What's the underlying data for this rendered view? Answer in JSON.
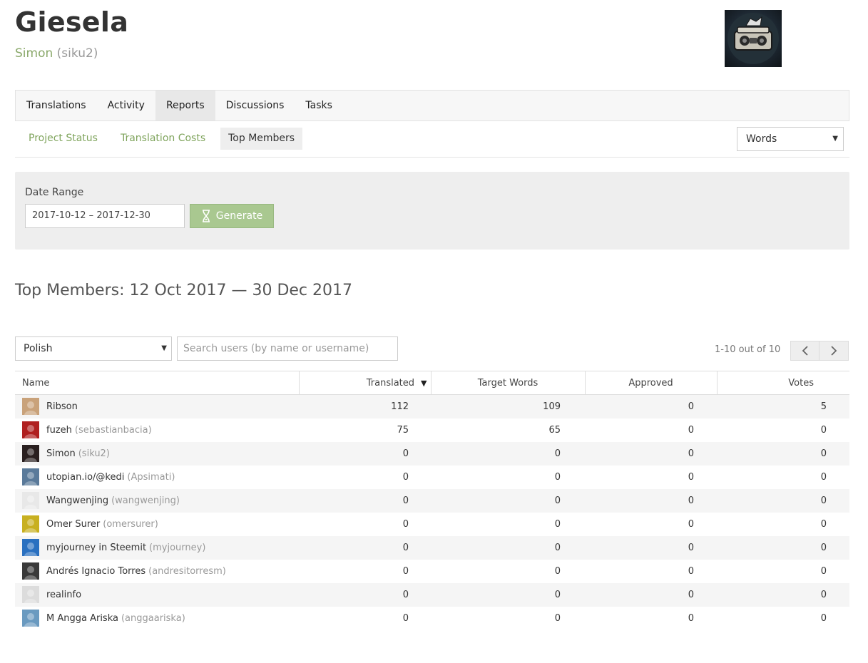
{
  "project": {
    "title": "Giesela",
    "owner_name": "Simon",
    "owner_username": "(siku2)"
  },
  "main_tabs": [
    {
      "label": "Translations"
    },
    {
      "label": "Activity"
    },
    {
      "label": "Reports",
      "active": true
    },
    {
      "label": "Discussions"
    },
    {
      "label": "Tasks"
    }
  ],
  "report_tabs": [
    {
      "label": "Project Status"
    },
    {
      "label": "Translation Costs"
    },
    {
      "label": "Top Members",
      "active": true
    }
  ],
  "units_select": {
    "value": "Words"
  },
  "filters": {
    "date_label": "Date Range",
    "date_value": "2017-10-12 – 2017-12-30",
    "generate_label": "Generate"
  },
  "report_title": "Top Members: 12 Oct 2017 — 30 Dec 2017",
  "language_select": {
    "value": "Polish"
  },
  "search": {
    "placeholder": "Search users (by name or username)"
  },
  "pagination": {
    "info": "1-10 out of 10"
  },
  "table": {
    "columns": [
      "Name",
      "Translated",
      "Target Words",
      "Approved",
      "Votes"
    ],
    "sorted_column": "Translated",
    "rows": [
      {
        "name": "Ribson",
        "username": "",
        "translated": "112",
        "target_words": "109",
        "approved": "0",
        "votes": "5",
        "avatar_color": "#c9a27a"
      },
      {
        "name": "fuzeh",
        "username": "(sebastianbacia)",
        "translated": "75",
        "target_words": "65",
        "approved": "0",
        "votes": "0",
        "avatar_color": "#b02020"
      },
      {
        "name": "Simon",
        "username": "(siku2)",
        "translated": "0",
        "target_words": "0",
        "approved": "0",
        "votes": "0",
        "avatar_color": "#2a2020"
      },
      {
        "name": "utopian.io/@kedi",
        "username": "(Apsimati)",
        "translated": "0",
        "target_words": "0",
        "approved": "0",
        "votes": "0",
        "avatar_color": "#5a7a9a"
      },
      {
        "name": "Wangwenjing",
        "username": "(wangwenjing)",
        "translated": "0",
        "target_words": "0",
        "approved": "0",
        "votes": "0",
        "avatar_color": "#e8e8e8"
      },
      {
        "name": "Omer Surer",
        "username": "(omersurer)",
        "translated": "0",
        "target_words": "0",
        "approved": "0",
        "votes": "0",
        "avatar_color": "#c8b020"
      },
      {
        "name": "myjourney in Steemit",
        "username": "(myjourney)",
        "translated": "0",
        "target_words": "0",
        "approved": "0",
        "votes": "0",
        "avatar_color": "#2a70c0"
      },
      {
        "name": "Andrés Ignacio Torres",
        "username": "(andresitorresm)",
        "translated": "0",
        "target_words": "0",
        "approved": "0",
        "votes": "0",
        "avatar_color": "#3a3a3a"
      },
      {
        "name": "realinfo",
        "username": "",
        "translated": "0",
        "target_words": "0",
        "approved": "0",
        "votes": "0",
        "avatar_color": "#dcdcdc"
      },
      {
        "name": "M Angga Ariska",
        "username": "(anggaariska)",
        "translated": "0",
        "target_words": "0",
        "approved": "0",
        "votes": "0",
        "avatar_color": "#6a9ac0"
      }
    ]
  }
}
